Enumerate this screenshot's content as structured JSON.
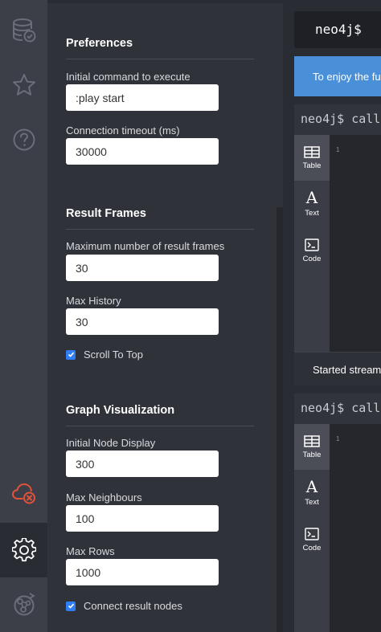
{
  "app": {
    "prompt": "neo4j$"
  },
  "sidebar": {
    "items": [
      {
        "icon": "database-icon"
      },
      {
        "icon": "star-icon"
      },
      {
        "icon": "help-icon"
      },
      {
        "icon": "disconnected-cloud-icon"
      },
      {
        "icon": "gear-icon"
      },
      {
        "icon": "sync-icon"
      }
    ],
    "colors": {
      "rail": "#3d3f48",
      "error": "#e0533a"
    }
  },
  "settings": {
    "preferences": {
      "title": "Preferences",
      "initial_command_label": "Initial command to execute",
      "initial_command_value": ":play start",
      "connection_timeout_label": "Connection timeout (ms)",
      "connection_timeout_value": "30000"
    },
    "result_frames": {
      "title": "Result Frames",
      "max_frames_label": "Maximum number of result frames",
      "max_frames_value": "30",
      "max_history_label": "Max History",
      "max_history_value": "30",
      "scroll_to_top_label": "Scroll To Top",
      "scroll_to_top_checked": true
    },
    "graph_visualization": {
      "title": "Graph Visualization",
      "initial_node_display_label": "Initial Node Display",
      "initial_node_display_value": "300",
      "max_neighbours_label": "Max Neighbours",
      "max_neighbours_value": "100",
      "max_rows_label": "Max Rows",
      "max_rows_value": "1000",
      "connect_result_nodes_label": "Connect result nodes",
      "connect_result_nodes_checked": true
    }
  },
  "workspace": {
    "editor_prompt": "neo4j$",
    "banner_text": "To enjoy the fu",
    "frames": [
      {
        "command": "neo4j$ call",
        "row_number": "1",
        "tabs": [
          {
            "label": "Table"
          },
          {
            "label": "Text"
          },
          {
            "label": "Code"
          }
        ],
        "footer": "Started stream"
      },
      {
        "command": "neo4j$ call",
        "row_number": "1",
        "tabs": [
          {
            "label": "Table"
          },
          {
            "label": "Text"
          },
          {
            "label": "Code"
          }
        ]
      }
    ],
    "colors": {
      "banner": "#4a90d9",
      "checkbox": "#2f7ef6"
    }
  }
}
